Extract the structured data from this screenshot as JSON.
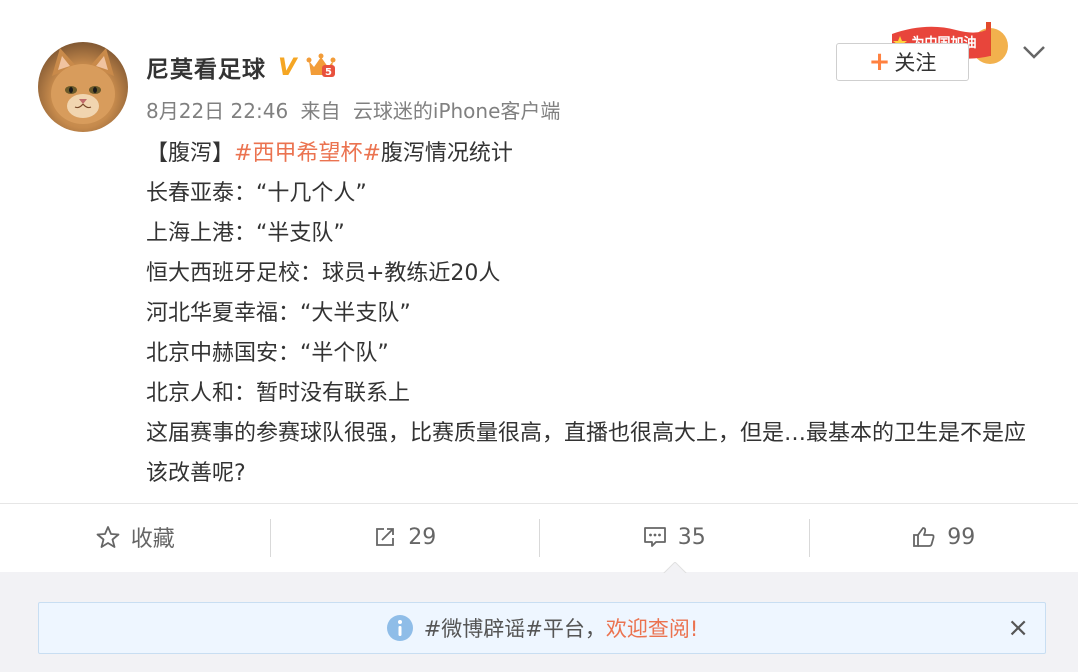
{
  "user": {
    "name": "尼莫看足球",
    "verified_badge": "V",
    "avatar_icon": "cat-avatar"
  },
  "meta": {
    "time": "8月22日 22:46",
    "from_label": "来自",
    "source": "云球迷的iPhone客户端"
  },
  "campaign_badge": "为中国加油",
  "follow": {
    "plus": "+",
    "label": "关注"
  },
  "post": {
    "line1": {
      "prefix": "【腹泻】",
      "tag": "#西甲希望杯#",
      "suffix": "腹泻情况统计"
    },
    "lines": [
      "长春亚泰：“十几个人”",
      "上海上港：“半支队”",
      "恒大西班牙足校：球员+教练近20人",
      "河北华夏幸福：“大半支队”",
      "北京中赫国安：“半个队”",
      "北京人和：暂时没有联系上"
    ],
    "closing": "这届赛事的参赛球队很强，比赛质量很高，直播也很高大上，但是…最基本的卫生是不是应该改善呢?"
  },
  "actions": {
    "favorite": "收藏",
    "repost": "29",
    "comment": "35",
    "like": "99"
  },
  "notice": {
    "text": "#微博辟谣#平台，",
    "link": "欢迎查阅!",
    "close": "×"
  },
  "colors": {
    "accent": "#eb7350",
    "verified": "#f5a623",
    "follow_plus": "#ff8140",
    "notice_bg": "#eef6ff"
  }
}
